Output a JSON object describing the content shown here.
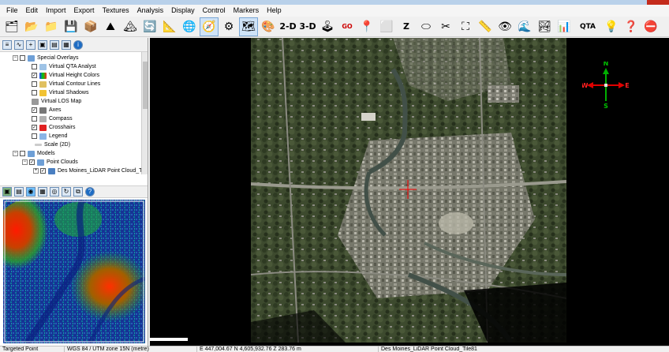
{
  "menu": [
    "File",
    "Edit",
    "Import",
    "Export",
    "Textures",
    "Analysis",
    "Display",
    "Control",
    "Markers",
    "Help"
  ],
  "toolbar": {
    "btn_2d": "2-D",
    "btn_3d": "3-D",
    "btn_go": "GO",
    "btn_z": "Z",
    "btn_qta": "QTA"
  },
  "tree": {
    "special_overlays": "Special Overlays",
    "virtual_qta": "Virtual QTA Analyst",
    "virtual_height_colors": "Virtual Height Colors",
    "virtual_contour_lines": "Virtual Contour Lines",
    "virtual_shadows": "Virtual Shadows",
    "virtual_los_map": "Virtual LOS Map",
    "axes": "Axes",
    "compass": "Compass",
    "crosshairs": "Crosshairs",
    "legend": "Legend",
    "scale": "Scale (2D)",
    "models": "Models",
    "point_clouds": "Point Clouds",
    "des_moines_tile": "Des Moines_LiDAR Point Cloud_Tile..."
  },
  "compass": {
    "n": "N",
    "s": "S",
    "e": "E",
    "w": "W"
  },
  "status": {
    "mode": "Targeted Point",
    "crs": "WGS 84 / UTM zone 15N (metre)",
    "coords": "E 447,004.67  N 4,605,932.76  Z 283.76 m",
    "layer": "Des Moines_LiDAR Point Cloud_Tile81"
  },
  "colors": {
    "accent": "#0078d7",
    "compass_ns": "#00b000",
    "compass_ew": "#e00000",
    "crosshair": "#ff0000"
  }
}
